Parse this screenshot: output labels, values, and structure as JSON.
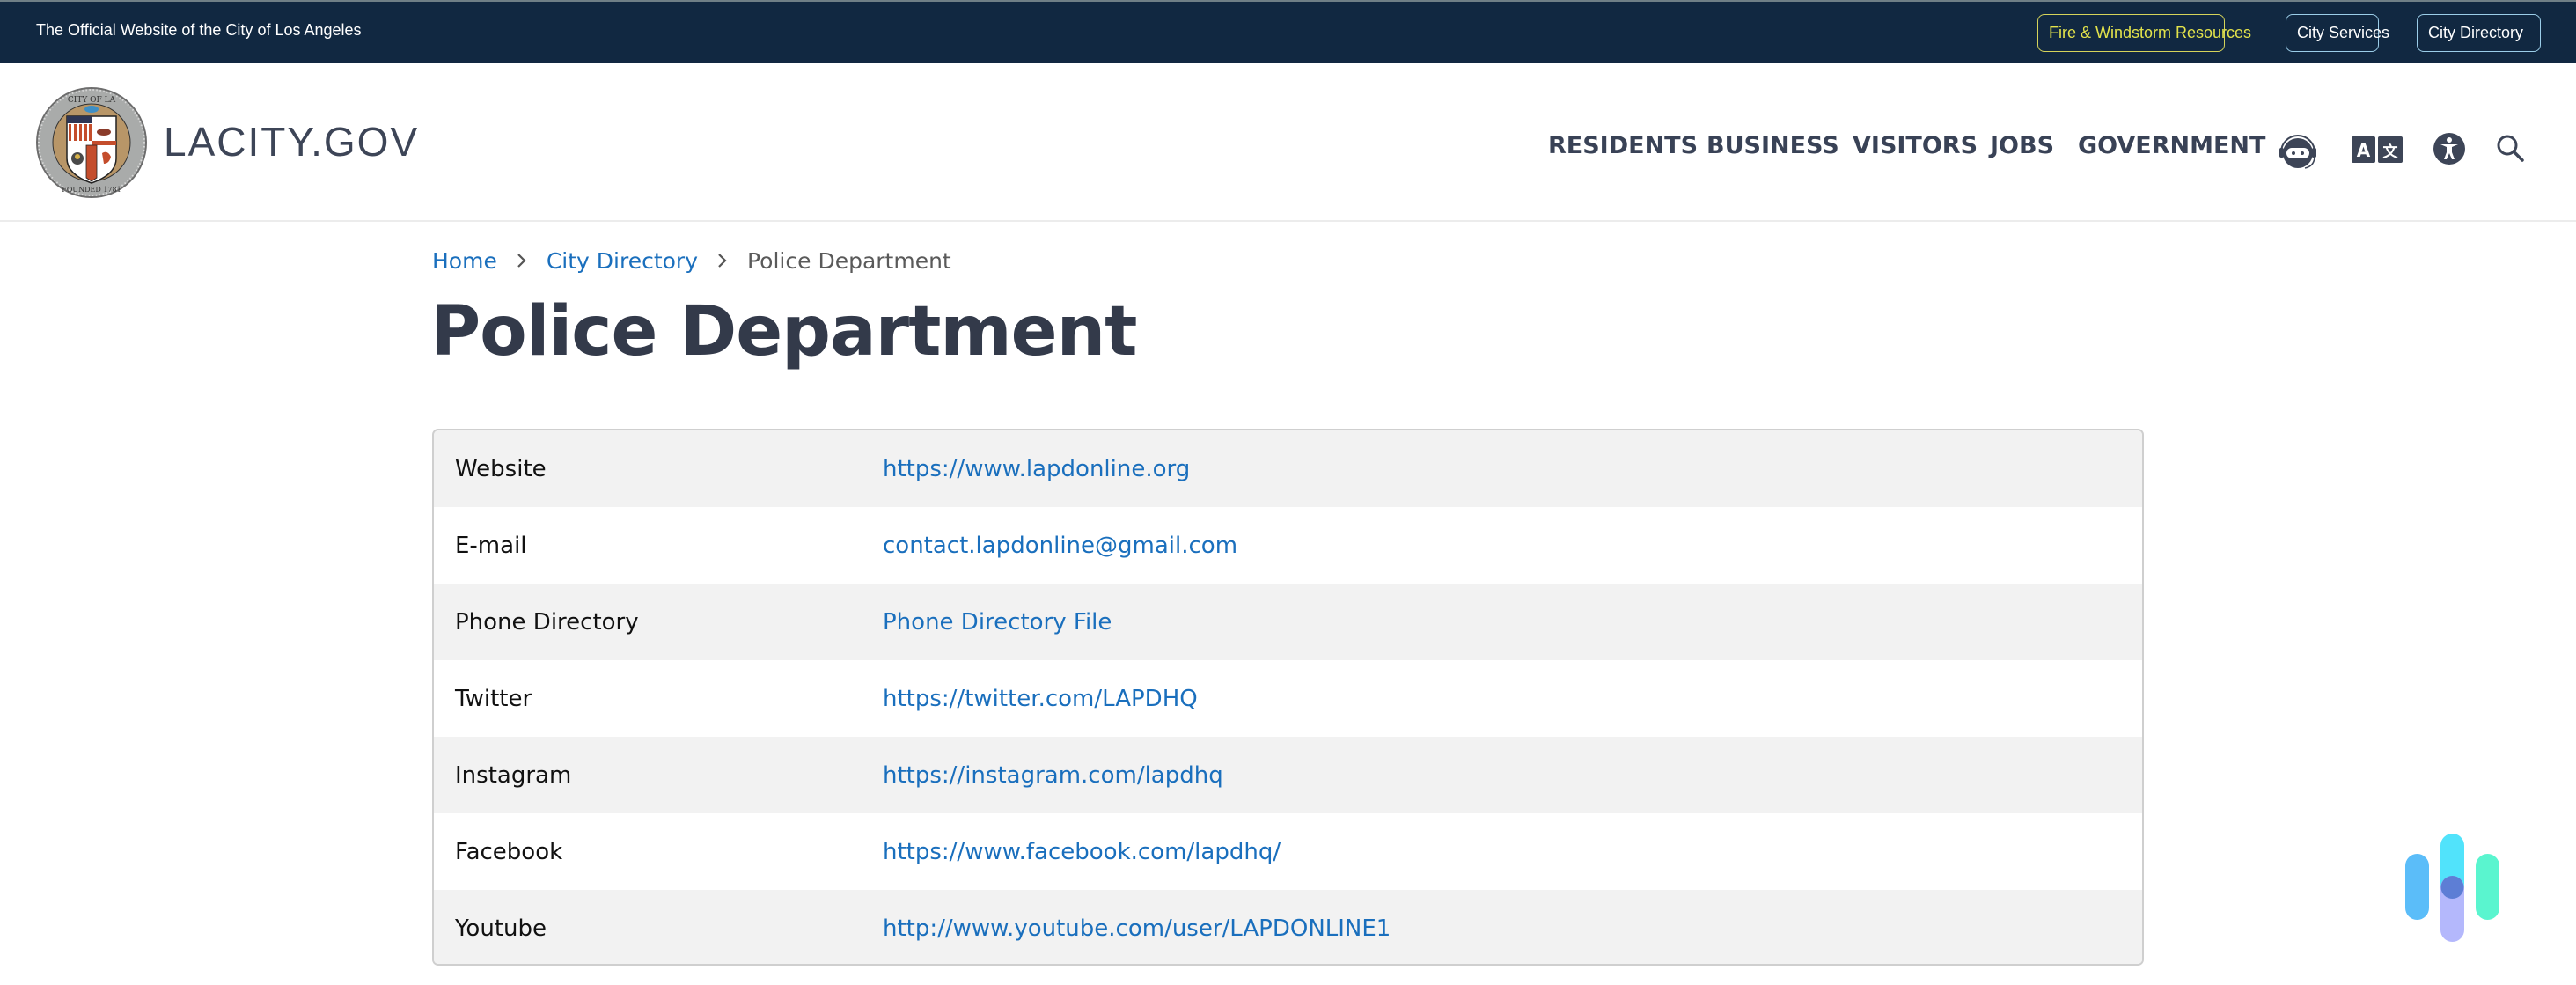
{
  "topbar": {
    "title": "The Official Website of the City of Los Angeles",
    "buttons": [
      {
        "label": "Fire & Windstorm Resources",
        "color": "#e3e34b"
      },
      {
        "label": "City Services"
      },
      {
        "label": "City Directory"
      }
    ]
  },
  "header": {
    "brand": "LACITY.GOV",
    "logo_icon": "city-of-los-angeles-seal",
    "nav": [
      "RESIDENTS",
      "BUSINESS",
      "VISITORS",
      "JOBS",
      "GOVERNMENT"
    ],
    "icons": [
      "chatbot-icon",
      "translate-icon",
      "accessibility-icon",
      "search-icon"
    ]
  },
  "breadcrumb": {
    "items": [
      {
        "label": "Home",
        "link": true
      },
      {
        "label": "City Directory",
        "link": true
      },
      {
        "label": "Police Department",
        "link": false
      }
    ],
    "separator": "›"
  },
  "page": {
    "title": "Police Department"
  },
  "info_table": {
    "rows": [
      {
        "label": "Website",
        "value": "https://www.lapdonline.org"
      },
      {
        "label": "E-mail",
        "value": "contact.lapdonline@gmail.com"
      },
      {
        "label": "Phone Directory",
        "value": "Phone Directory File"
      },
      {
        "label": "Twitter",
        "value": "https://twitter.com/LAPDHQ"
      },
      {
        "label": "Instagram",
        "value": "https://instagram.com/lapdhq"
      },
      {
        "label": "Facebook",
        "value": "https://www.facebook.com/lapdhq/"
      },
      {
        "label": "Youtube",
        "value": "http://www.youtube.com/user/LAPDONLINE1"
      }
    ]
  },
  "colors": {
    "topbar_bg": "#112841",
    "link": "#1a6fbd",
    "heading": "#333a4a",
    "nav": "#394256",
    "row_alt": "#f2f2f2"
  },
  "floating_widget": {
    "icon": "assistant-widget-icon"
  }
}
